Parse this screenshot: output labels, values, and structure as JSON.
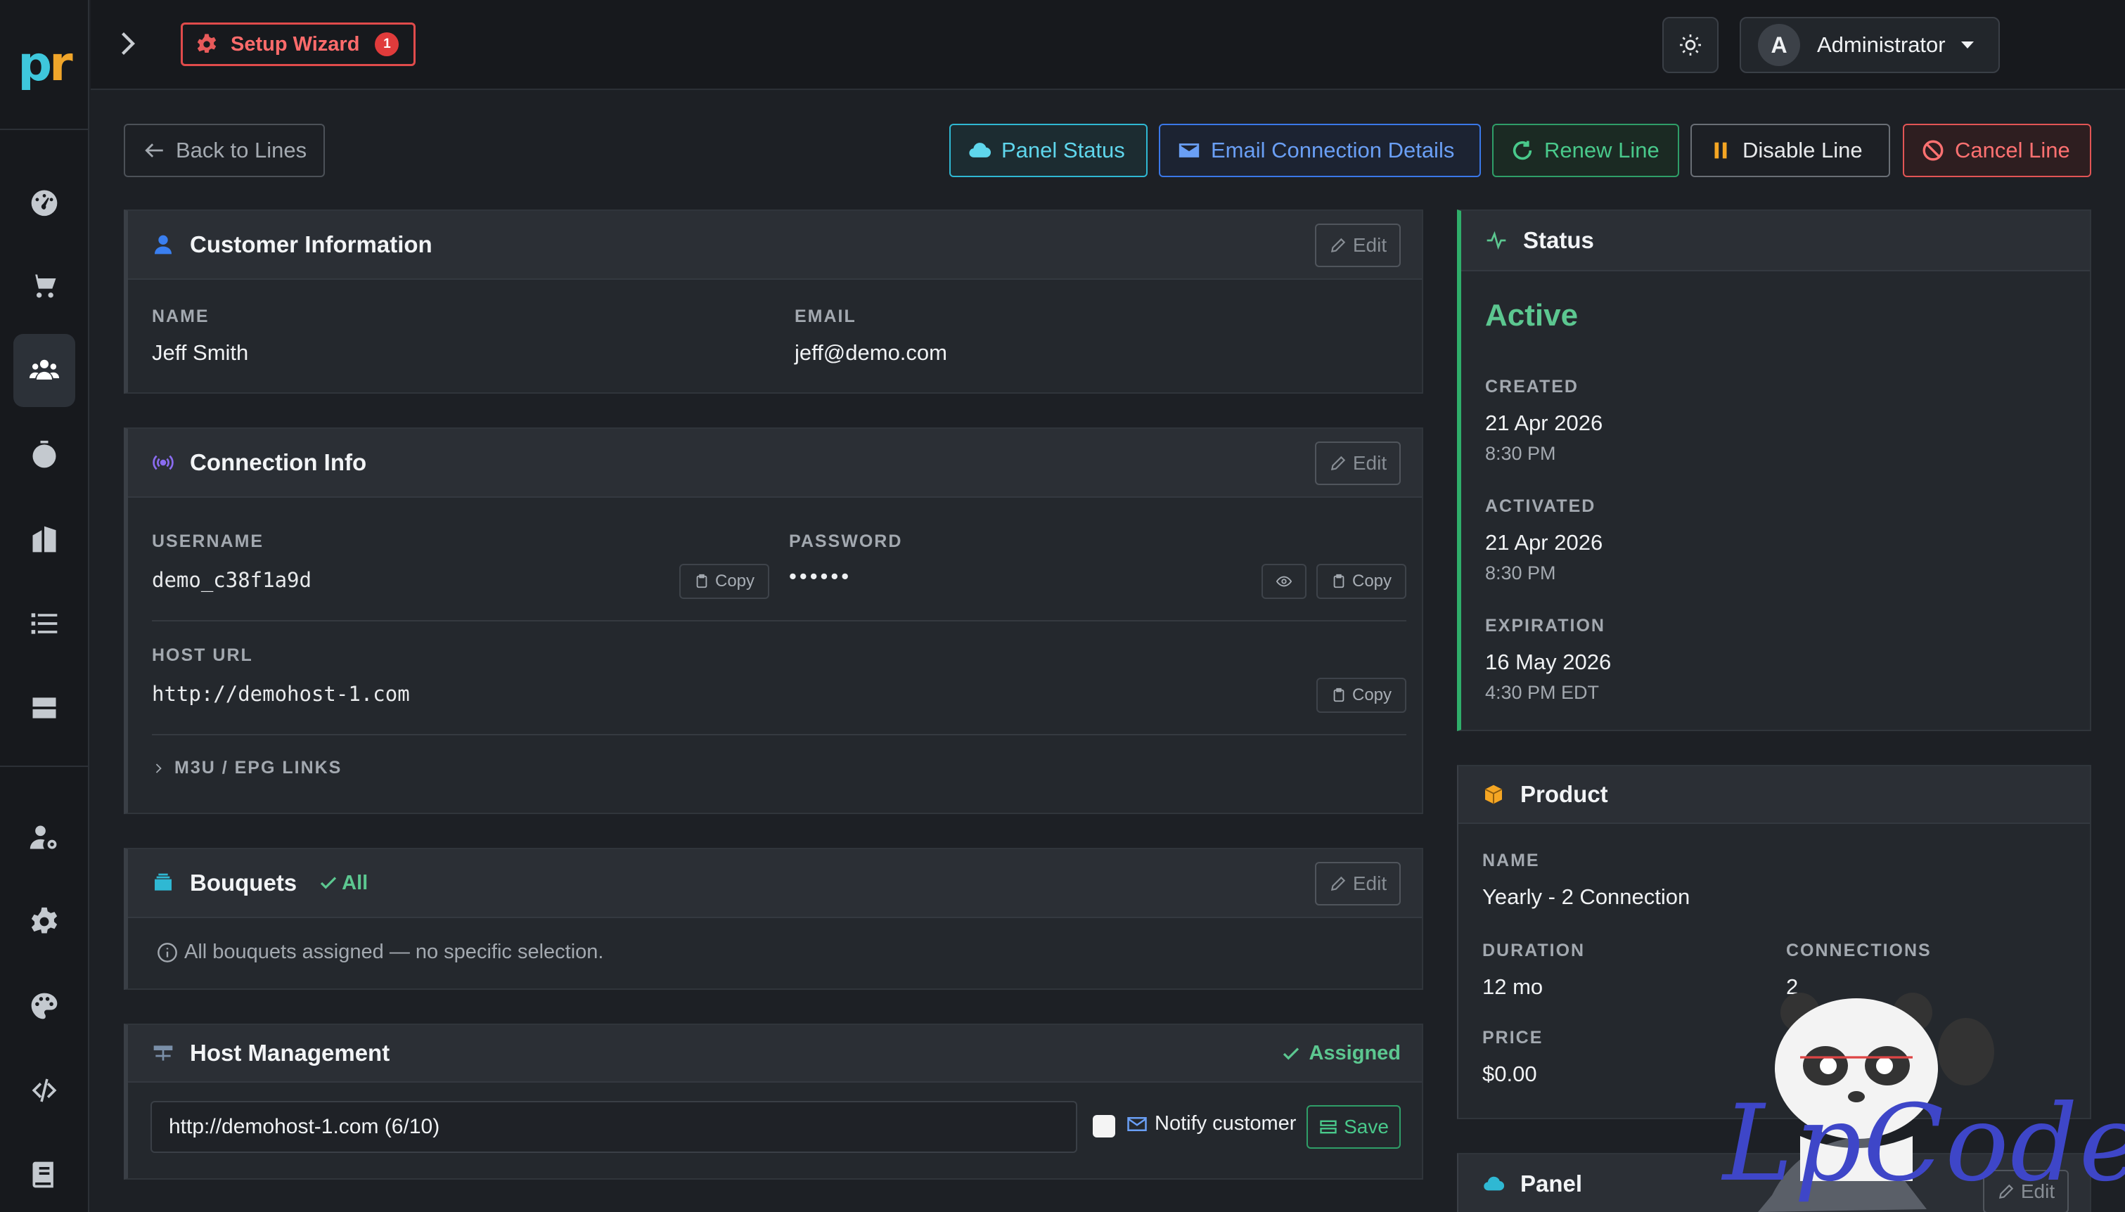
{
  "brand": {
    "logo_left": "p",
    "logo_right": "r"
  },
  "topbar": {
    "wizard_label": "Setup Wizard",
    "wizard_badge": "1",
    "user_initial": "A",
    "user_name": "Administrator"
  },
  "actions": {
    "back": "Back to Lines",
    "panel_status": "Panel Status",
    "email": "Email Connection Details",
    "renew": "Renew Line",
    "disable": "Disable Line",
    "cancel": "Cancel Line"
  },
  "customer": {
    "title": "Customer Information",
    "edit": "Edit",
    "name_label": "NAME",
    "name": "Jeff Smith",
    "email_label": "EMAIL",
    "email": "jeff@demo.com"
  },
  "connection": {
    "title": "Connection Info",
    "edit": "Edit",
    "username_label": "USERNAME",
    "username": "demo_c38f1a9d",
    "password_label": "PASSWORD",
    "password": "••••••",
    "host_label": "HOST URL",
    "host": "http://demohost-1.com",
    "copy": "Copy",
    "links_label": "M3U / EPG LINKS"
  },
  "bouquets": {
    "title": "Bouquets",
    "all": "All",
    "edit": "Edit",
    "note": "All bouquets assigned — no specific selection."
  },
  "host_mgmt": {
    "title": "Host Management",
    "assigned": "Assigned",
    "selected": "http://demohost-1.com (6/10)",
    "notify": "Notify customer",
    "save": "Save"
  },
  "status": {
    "title": "Status",
    "value": "Active",
    "created_label": "CREATED",
    "created_date": "21 Apr 2026",
    "created_time": "8:30 PM",
    "activated_label": "ACTIVATED",
    "activated_date": "21 Apr 2026",
    "activated_time": "8:30 PM",
    "expiration_label": "EXPIRATION",
    "expiration_date": "16 May 2026",
    "expiration_time": "4:30 PM EDT"
  },
  "product": {
    "title": "Product",
    "name_label": "NAME",
    "name": "Yearly - 2 Connection",
    "duration_label": "DURATION",
    "duration": "12 mo",
    "connections_label": "CONNECTIONS",
    "connections": "2",
    "price_label": "PRICE",
    "price": "$0.00"
  },
  "panel": {
    "title": "Panel",
    "edit": "Edit"
  },
  "watermark": "LpCodes",
  "colors": {
    "accent_green": "#5cc790",
    "accent_cyan": "#2fb8d3",
    "accent_blue": "#3a78e8",
    "danger": "#e25555"
  }
}
